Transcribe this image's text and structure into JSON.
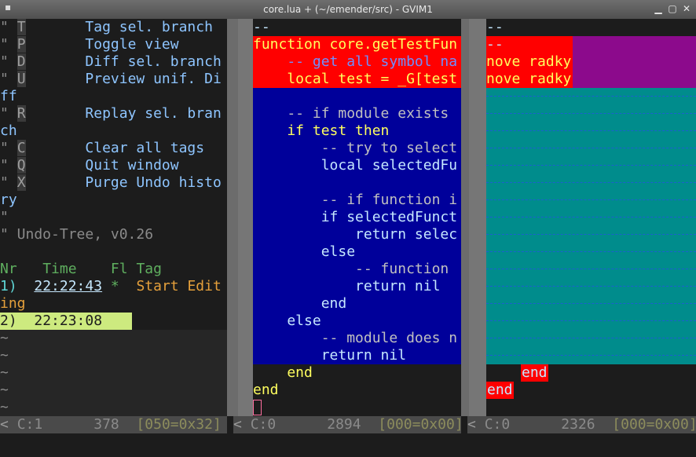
{
  "window": {
    "title": "core.lua + (~/emender/src) - GVIM1",
    "menu_icon": "▪",
    "minimize": "▁",
    "maximize": "▢",
    "close": "✕"
  },
  "left": {
    "help": [
      {
        "quote": "\"",
        "key": "T",
        "desc": "Tag sel. branch"
      },
      {
        "quote": "\"",
        "key": "P",
        "desc": "Toggle view"
      },
      {
        "quote": "\"",
        "key": "D",
        "desc": "Diff sel. branch"
      },
      {
        "quote": "\"",
        "key": "U",
        "desc": "Preview unif. Di"
      },
      {
        "wrap": "ff"
      },
      {
        "quote": "\"",
        "key": "R",
        "desc": "Replay sel. bran"
      },
      {
        "wrap": "ch"
      },
      {
        "quote": "\"",
        "key": "C",
        "desc": "Clear all tags"
      },
      {
        "quote": "\"",
        "key": "Q",
        "desc": "Quit window"
      },
      {
        "quote": "\"",
        "key": "X",
        "desc": "Purge Undo histo"
      },
      {
        "wrap": "ry"
      },
      {
        "wrap": "\""
      }
    ],
    "version": "\" Undo-Tree, v0.26",
    "header": {
      "nr": "Nr",
      "time": "Time",
      "fl": "Fl",
      "tag": "Tag"
    },
    "entries": [
      {
        "nr": "1)",
        "time": "22:22:43",
        "flag": "*",
        "tag": "Start Edit",
        "wrap": "ing"
      },
      {
        "nr": "2)",
        "time": "22:23:08"
      }
    ],
    "tilde": "~"
  },
  "middle": {
    "top": "--",
    "lines": [
      "function core.getTestFun",
      "    -- get all symbol na",
      "    local test = _G[test",
      "",
      "    -- if module exists",
      "    if test then",
      "        -- try to select",
      "        local selectedFu",
      "",
      "        -- if function i",
      "        if selectedFunct",
      "            return selec",
      "        else",
      "            -- function",
      "            return nil",
      "        end",
      "    else",
      "        -- module does n",
      "        return nil",
      "    end",
      "end"
    ]
  },
  "right": {
    "top": "--",
    "lines": [
      "--",
      "nove radky",
      "nove radky",
      "end",
      "end"
    ]
  },
  "status": {
    "left": {
      "arrow": "<",
      "col": "C:1",
      "num": "378",
      "hex": "[050=0x32]"
    },
    "mid": {
      "arrow": "<",
      "col": "C:0",
      "num": "2894",
      "hex": "[000=0x00]"
    },
    "right": {
      "arrow": "<",
      "col": "C:0",
      "num": "2326",
      "hex": "[000=0x00]"
    }
  }
}
